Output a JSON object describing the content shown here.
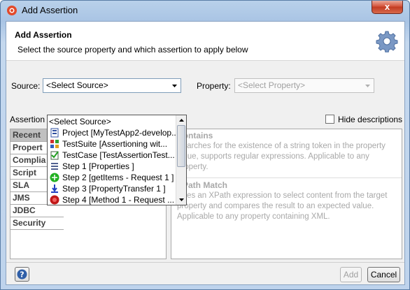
{
  "window": {
    "title": "Add Assertion",
    "close_symbol": "x"
  },
  "header": {
    "title": "Add Assertion",
    "subtitle": "Select the source property and which assertion to apply below"
  },
  "source": {
    "label": "Source:",
    "value": "<Select Source>"
  },
  "property": {
    "label": "Property:",
    "value": "<Select Property>"
  },
  "assertions_label": "Assertion",
  "hide_descriptions": {
    "label": "Hide descriptions",
    "checked": false
  },
  "dropdown": {
    "items": [
      {
        "text": "<Select Source>",
        "icon": "none"
      },
      {
        "text": "Project [MyTestApp2-develop...",
        "icon": "project-icon"
      },
      {
        "text": "TestSuite [Assertioning wit...",
        "icon": "testsuite-icon"
      },
      {
        "text": "TestCase [TestAssertionTest...",
        "icon": "testcase-icon"
      },
      {
        "text": "Step 1 [Properties ]",
        "icon": "properties-step-icon"
      },
      {
        "text": "Step 2 [getItems - Request 1 ]",
        "icon": "request-step-icon"
      },
      {
        "text": "Step 3 [PropertyTransfer 1 ]",
        "icon": "transfer-step-icon"
      },
      {
        "text": "Step 4 [Method 1 - Request ...",
        "icon": "method-step-icon"
      }
    ]
  },
  "categories": [
    {
      "label": "Recent",
      "selected": true
    },
    {
      "label": "Propert",
      "selected": false
    },
    {
      "label": "Complia",
      "selected": false
    },
    {
      "label": "Script",
      "selected": false
    },
    {
      "label": "SLA",
      "selected": false
    },
    {
      "label": "JMS",
      "selected": false
    },
    {
      "label": "JDBC",
      "selected": false
    },
    {
      "label": "Security",
      "selected": false
    }
  ],
  "assertions": [
    {
      "name": "Contains",
      "desc": "Searches for the existence of a string token in the property value, supports regular expressions. Applicable to any property."
    },
    {
      "name": "XPath Match",
      "desc": "Uses an XPath expression to select content from the target property and compares the result to an expected value. Applicable to any property containing XML."
    }
  ],
  "buttons": {
    "add": "Add",
    "cancel": "Cancel"
  },
  "colors": {
    "title_gradient_top": "#b9d1ea",
    "close_red": "#c23b22",
    "selection_gray": "#c0c0c0"
  }
}
